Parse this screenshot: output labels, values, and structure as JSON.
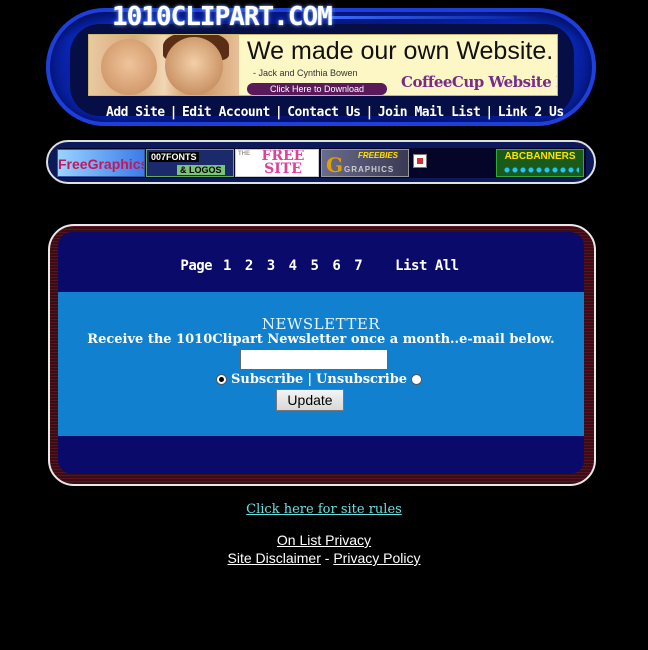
{
  "site": {
    "title": "1010CLIPART.COM"
  },
  "ad": {
    "headline": "We made our own Website.",
    "credit": "- Jack and Cynthia Bowen",
    "cta": "Click Here to Download",
    "brand": "CoffeeCup Website Design Software"
  },
  "nav": {
    "items": [
      "Add Site",
      "Edit Account",
      "Contact Us",
      "Join Mail List",
      "Link 2 Us"
    ],
    "separator": "|"
  },
  "sponsors": {
    "free_graphics": "FreeGraphics",
    "fonts_line1": "007FONTS",
    "fonts_line2": "& LOGOS",
    "free_site_the": "THE",
    "free_site": "FREE SITE",
    "g_freebies": "FREEBIES",
    "g_letter": "G",
    "g_graphics": "GRAPHICS",
    "abc": "ABCBANNERS"
  },
  "pager": {
    "label": "Page",
    "pages": [
      "1",
      "2",
      "3",
      "4",
      "5",
      "6",
      "7"
    ],
    "list_all": "List All"
  },
  "newsletter": {
    "title": "NEWSLETTER",
    "description": "Receive the 1010Clipart Newsletter once a month..e-mail below.",
    "email_value": "",
    "subscribe_label": "Subscribe",
    "divider": "|",
    "unsubscribe_label": "Unsubscribe",
    "selected": "subscribe",
    "button_label": "Update"
  },
  "footer": {
    "rules_link": "Click here for site rules",
    "on_list_privacy": "On List Privacy",
    "site_disclaimer": "Site Disclaimer",
    "dash": "-",
    "privacy_policy": "Privacy Policy"
  }
}
